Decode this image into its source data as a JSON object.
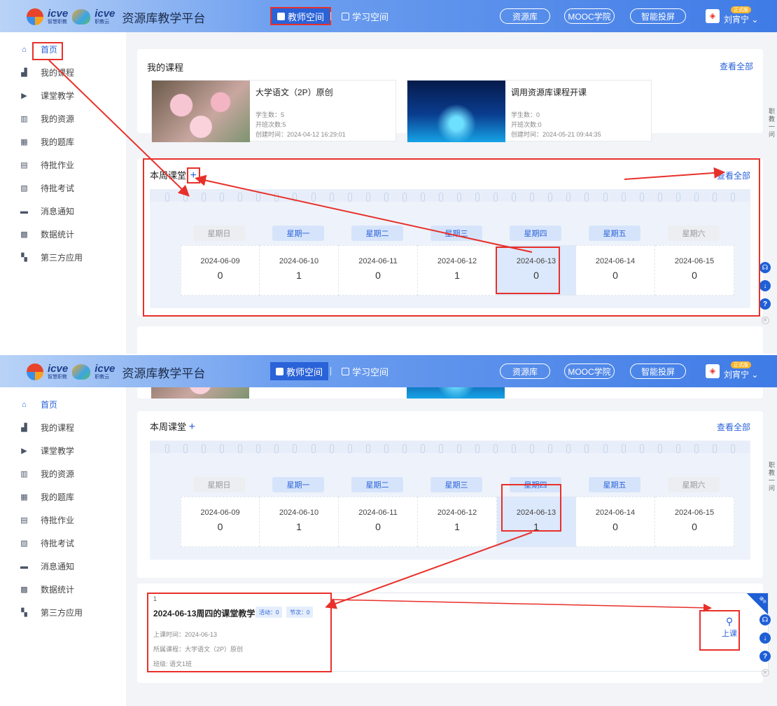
{
  "header": {
    "logo1_text": "icve",
    "logo1_sub": "智慧职教",
    "logo2_text": "icve",
    "logo2_sub": "职教云",
    "platform_title": "资源库教学平台",
    "teacher_space": "教师空间",
    "study_space": "学习空间",
    "pills": [
      "资源库",
      "MOOC学院",
      "智能投屏"
    ],
    "badge": "正式版",
    "user_name": "刘宵宁"
  },
  "sidebar": {
    "items": [
      "首页",
      "我的课程",
      "课堂教学",
      "我的资源",
      "我的题库",
      "待批作业",
      "待批考试",
      "消息通知",
      "数据统计",
      "第三方应用"
    ],
    "icons": [
      "home-icon",
      "course-icon",
      "classroom-icon",
      "resource-icon",
      "question-bank-icon",
      "homework-icon",
      "exam-icon",
      "message-icon",
      "statistics-icon",
      "apps-icon"
    ]
  },
  "my_courses": {
    "title": "我的课程",
    "view_all": "查看全部",
    "courses": [
      {
        "name": "大学语文（2P）原创",
        "students": "学生数：5",
        "classes": "开班次数:5",
        "created": "创建时间：2024-04-12 16:29:01"
      },
      {
        "name": "调用资源库课程开课",
        "students": "学生数：0",
        "classes": "开班次数:0",
        "created": "创建时间：2024-05-21 09:44:35"
      }
    ]
  },
  "week": {
    "title": "本周课堂",
    "add": "+",
    "view_all": "查看全部",
    "days": [
      "星期日",
      "星期一",
      "星期二",
      "星期三",
      "星期四",
      "星期五",
      "星期六"
    ],
    "dates": [
      "2024-06-09",
      "2024-06-10",
      "2024-06-11",
      "2024-06-12",
      "2024-06-13",
      "2024-06-14",
      "2024-06-15"
    ],
    "counts_before": [
      "0",
      "1",
      "0",
      "1",
      "0",
      "0",
      "0"
    ],
    "counts_after": [
      "0",
      "1",
      "0",
      "1",
      "1",
      "0",
      "0"
    ]
  },
  "lesson": {
    "index": "1",
    "title": "2024-06-13周四的课堂教学",
    "activities": "活动：0",
    "sessions": "节次：0",
    "time": "上课时间：2024-06-13",
    "course": "所属课程：大学语文（2P）原创",
    "class": "班级: 语文1班",
    "start_label": "上课",
    "ribbon": "课中"
  },
  "edge_text": "职教一问",
  "colors": {
    "accent": "#2a62d8",
    "highlight": "#e8302a"
  }
}
